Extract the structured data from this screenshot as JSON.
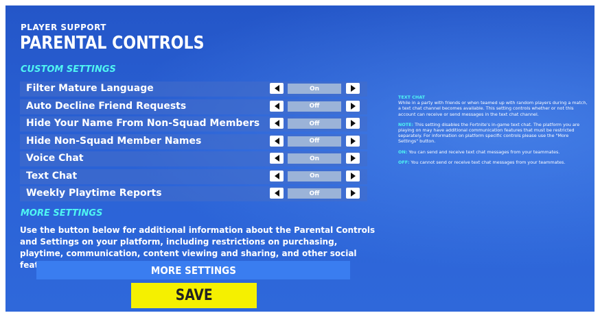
{
  "header": {
    "kicker": "PLAYER SUPPORT",
    "title": "PARENTAL CONTROLS"
  },
  "custom_settings": {
    "heading": "CUSTOM SETTINGS",
    "rows": [
      {
        "label": "Filter Mature Language",
        "value": "On"
      },
      {
        "label": "Auto Decline Friend Requests",
        "value": "Off"
      },
      {
        "label": "Hide Your Name From Non-Squad Members",
        "value": "Off"
      },
      {
        "label": "Hide Non-Squad Member Names",
        "value": "Off"
      },
      {
        "label": "Voice Chat",
        "value": "On"
      },
      {
        "label": "Text Chat",
        "value": "On"
      },
      {
        "label": "Weekly Playtime Reports",
        "value": "Off"
      }
    ]
  },
  "more_settings": {
    "heading": "MORE SETTINGS",
    "description": "Use the button below for additional information about the Parental Controls and Settings on your platform, including restrictions on purchasing, playtime, communication, content viewing and sharing, and other social features.",
    "button_label": "MORE SETTINGS"
  },
  "save_label": "SAVE",
  "info_panel": {
    "heading": "TEXT CHAT",
    "body": "While in a party with friends or when teamed up with random players during a match, a text chat channel becomes available. This setting controls whether or not this account can receive or send messages in the text chat channel.",
    "note_label": "NOTE:",
    "note_text": " This setting disables the Fortnite's in-game text chat. The platform you are playing on may have additional communication features that must be restricted separately. For information on platform specific controls please use the \"More Settings\" button.",
    "on_label": "ON:",
    "on_text": " You can send and receive text chat messages from your teammates.",
    "off_label": "OFF:",
    "off_text": " You cannot send or receive text chat messages from your teammates."
  },
  "colors": {
    "accent_cyan": "#4ff5f2",
    "save_yellow": "#f5f000",
    "background_blue": "#2a62d6"
  }
}
